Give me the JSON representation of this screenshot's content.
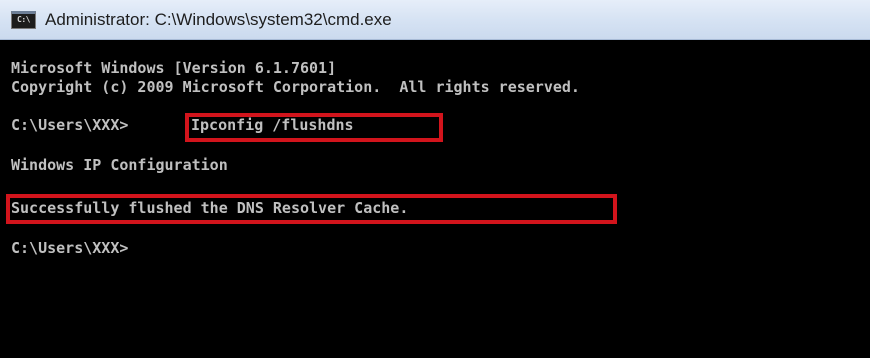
{
  "window": {
    "title": "Administrator: C:\\Windows\\system32\\cmd.exe",
    "icon_text": "C:\\"
  },
  "console": {
    "lines": [
      "Microsoft Windows [Version 6.1.7601]",
      "Copyright (c) 2009 Microsoft Corporation.  All rights reserved.",
      "C:\\Users\\XXX>",
      "Ipconfig /flushdns",
      "Windows IP Configuration",
      "Successfully flushed the DNS Resolver Cache.",
      "C:\\Users\\XXX>"
    ]
  },
  "colors": {
    "highlight": "#d2141c",
    "text": "#c0c0c0",
    "background": "#000000"
  }
}
